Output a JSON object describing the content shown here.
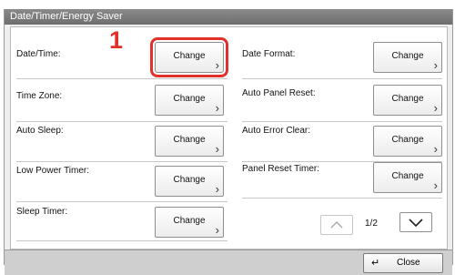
{
  "window": {
    "title": "Date/Timer/Energy Saver"
  },
  "callout": "1",
  "settings": [
    {
      "label": "Date/Time:",
      "button": "Change"
    },
    {
      "label": "Date Format:",
      "button": "Change"
    },
    {
      "label": "Time Zone:",
      "button": "Change"
    },
    {
      "label": "Auto Panel Reset:",
      "button": "Change"
    },
    {
      "label": "Auto Sleep:",
      "button": "Change"
    },
    {
      "label": "Auto Error Clear:",
      "button": "Change"
    },
    {
      "label": "Low Power Timer:",
      "button": "Change"
    },
    {
      "label": "Panel Reset Timer:",
      "button": "Change"
    },
    {
      "label": "Sleep Timer:",
      "button": "Change"
    }
  ],
  "pagination": {
    "indicator": "1/2"
  },
  "footer": {
    "close_label": "Close",
    "close_icon": "return-arrow-icon"
  },
  "colors": {
    "highlight": "#e0322b",
    "titlebar": "#7b7b7b"
  }
}
